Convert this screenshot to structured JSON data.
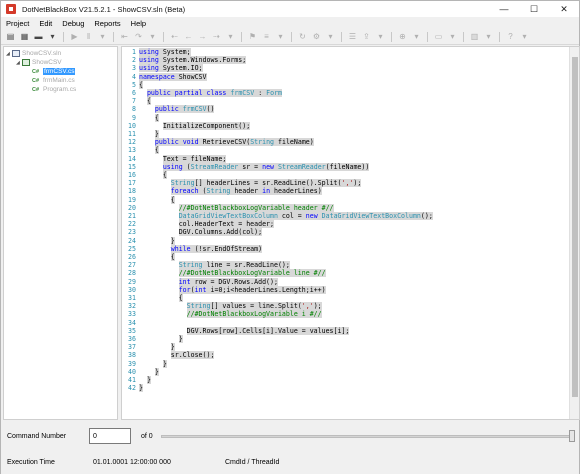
{
  "window": {
    "title": "DotNetBlackBox V21.5.2.1 - ShowCSV.sln (Beta)",
    "minimize": "—",
    "maximize": "☐",
    "close": "✕"
  },
  "menu": [
    "Project",
    "Edit",
    "Debug",
    "Reports",
    "Help"
  ],
  "tree": {
    "solution": "ShowCSV.sln",
    "project": "ShowCSV",
    "files": [
      "frmCSV.cs",
      "frmMain.cs",
      "Program.cs"
    ],
    "cs_badge": "C#"
  },
  "editor": {
    "lines": [
      {
        "n": "1",
        "t": "using System;",
        "hl": true
      },
      {
        "n": "2",
        "t": "using System.Windows.Forms;",
        "hl": true
      },
      {
        "n": "3",
        "t": "using System.IO;",
        "hl": true
      },
      {
        "n": "4",
        "t": "namespace ShowCSV",
        "hl": true
      },
      {
        "n": "5",
        "t": "{",
        "hl": true
      },
      {
        "n": "6",
        "t": "  public partial class frmCSV : Form",
        "hl": true
      },
      {
        "n": "7",
        "t": "  {",
        "hl": true
      },
      {
        "n": "8",
        "t": "    public frmCSV()",
        "hl": true
      },
      {
        "n": "9",
        "t": "    {",
        "hl": true
      },
      {
        "n": "10",
        "t": "      InitializeComponent();",
        "hl": true
      },
      {
        "n": "11",
        "t": "    }",
        "hl": true
      },
      {
        "n": "12",
        "t": "    public void RetrieveCSV(String fileName)",
        "hl": true
      },
      {
        "n": "13",
        "t": "    {",
        "hl": true
      },
      {
        "n": "14",
        "t": "      Text = fileName;",
        "hl": true
      },
      {
        "n": "15",
        "t": "      using (StreamReader sr = new StreamReader(fileName))",
        "hl": true
      },
      {
        "n": "16",
        "t": "      {",
        "hl": true
      },
      {
        "n": "17",
        "t": "        String[] headerLines = sr.ReadLine().Split(',');",
        "hl": true
      },
      {
        "n": "18",
        "t": "        foreach (String header in headerLines)",
        "hl": true
      },
      {
        "n": "19",
        "t": "        {",
        "hl": true
      },
      {
        "n": "20",
        "t": "          //#DotNetBlackboxLogVariable header #//",
        "hl": true
      },
      {
        "n": "21",
        "t": "          DataGridViewTextBoxColumn col = new DataGridViewTextBoxColumn();",
        "hl": true
      },
      {
        "n": "22",
        "t": "          col.HeaderText = header;",
        "hl": true
      },
      {
        "n": "23",
        "t": "          DGV.Columns.Add(col);",
        "hl": true
      },
      {
        "n": "24",
        "t": "        }",
        "hl": true
      },
      {
        "n": "25",
        "t": "        while (!sr.EndOfStream)",
        "hl": true
      },
      {
        "n": "26",
        "t": "        {",
        "hl": true
      },
      {
        "n": "27",
        "t": "          String line = sr.ReadLine();",
        "hl": true
      },
      {
        "n": "28",
        "t": "          //#DotNetBlackboxLogVariable line #//",
        "hl": true
      },
      {
        "n": "29",
        "t": "          int row = DGV.Rows.Add();",
        "hl": true
      },
      {
        "n": "30",
        "t": "          for(int i=0;i<headerLines.Length;i++)",
        "hl": true
      },
      {
        "n": "31",
        "t": "          {",
        "hl": true
      },
      {
        "n": "32",
        "t": "            String[] values = line.Split(',');",
        "hl": true
      },
      {
        "n": "33",
        "t": "            //#DotNetBlackboxLogVariable i #//",
        "hl": true
      },
      {
        "n": "34",
        "t": "",
        "hl": false
      },
      {
        "n": "35",
        "t": "            DGV.Rows[row].Cells[i].Value = values[i];",
        "hl": true
      },
      {
        "n": "36",
        "t": "          }",
        "hl": true
      },
      {
        "n": "37",
        "t": "        }",
        "hl": true
      },
      {
        "n": "38",
        "t": "        sr.Close();",
        "hl": true
      },
      {
        "n": "39",
        "t": "      }",
        "hl": true
      },
      {
        "n": "40",
        "t": "    }",
        "hl": true
      },
      {
        "n": "41",
        "t": "  }",
        "hl": true
      },
      {
        "n": "42",
        "t": "}",
        "hl": true
      }
    ]
  },
  "bottom": {
    "command_number_label": "Command Number",
    "command_number_value": "0",
    "of_text": "of 0",
    "execution_time_label": "Execution Time",
    "execution_time_value": "01.01.0001 12:00:00 000",
    "cmdid_label": "CmdId / ThreadId"
  },
  "colors": {
    "keyword": "#0000ff",
    "type": "#2b91af",
    "comment": "#008000",
    "string": "#a31515",
    "highlight": "#d8d8d8",
    "selection": "#3399ff"
  }
}
